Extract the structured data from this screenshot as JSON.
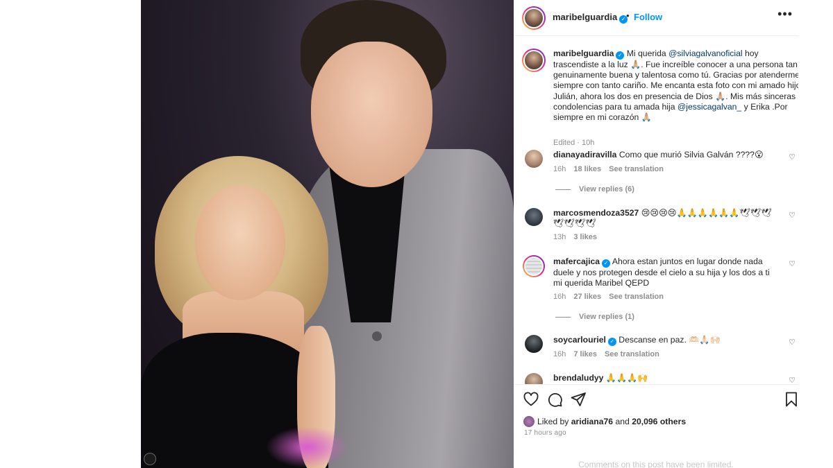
{
  "post": {
    "username": "maribelguardia",
    "follow_label": "Follow",
    "more_label": "•••"
  },
  "caption": {
    "username": "maribelguardia",
    "part1": " Mi querida ",
    "mention1": "@silviagalvanoficial",
    "part2": " hoy trascendiste a la luz 🙏🏼. Fue increíble conocer a una persona tan genuinamente buena y talentosa como tú. Gracias por atenderme siempre con tanto cariño. Me encanta esta foto con mi amado hijo Julián, ahora los dos en presencia de Dios 🙏🏼. Mis más sinceras condolencias para tu amada hija ",
    "mention2": "@jessicagalvan_",
    "part3": " y Erika .Por siempre en mi corazón 🙏🏼",
    "meta": "Edited · 10h"
  },
  "comments": [
    {
      "username": "dianayadiravilla",
      "verified": false,
      "text": "Como que murió Silvia Galván ????😮",
      "time": "16h",
      "likes": "18 likes",
      "translate": "See translation",
      "replies": "View replies (6)"
    },
    {
      "username": "marcosmendoza3527",
      "verified": false,
      "text": "😢😢😢😢🙏🙏🙏🙏🙏🙏🕊🕊🕊🕊🕊🕊🕊",
      "time": "13h",
      "likes": "3 likes",
      "translate": "",
      "replies": ""
    },
    {
      "username": "mafercajica",
      "verified": true,
      "text": "Ahora estan juntos en lugar donde nada duele y nos protegen desde el cielo a su hija y los dos a ti mi querida Maribel QEPD",
      "time": "16h",
      "likes": "27 likes",
      "translate": "See translation",
      "replies": "View replies (1)"
    },
    {
      "username": "soycarlouriel",
      "verified": true,
      "text": "Descanse en paz. 🫶🏻🙏🏻🙌🏻",
      "time": "16h",
      "likes": "7 likes",
      "translate": "See translation",
      "replies": ""
    },
    {
      "username": "brendaludyy",
      "verified": false,
      "text": "🙏🙏🙏🙌",
      "time": "",
      "likes": "",
      "translate": "",
      "replies": ""
    }
  ],
  "likes": {
    "prefix": "Liked by ",
    "user": "aridiana76",
    "suffix": " and ",
    "count": "20,096 others"
  },
  "timestamp": "17 hours ago",
  "limited_notice": "Comments on this post have been limited.",
  "icons": [
    "heart-icon",
    "comment-icon",
    "share-icon",
    "bookmark-icon",
    "verified-badge-icon",
    "more-options-icon"
  ],
  "colors": {
    "accent": "#0095f6",
    "mention": "#00376b",
    "muted": "#8e8e8e"
  }
}
